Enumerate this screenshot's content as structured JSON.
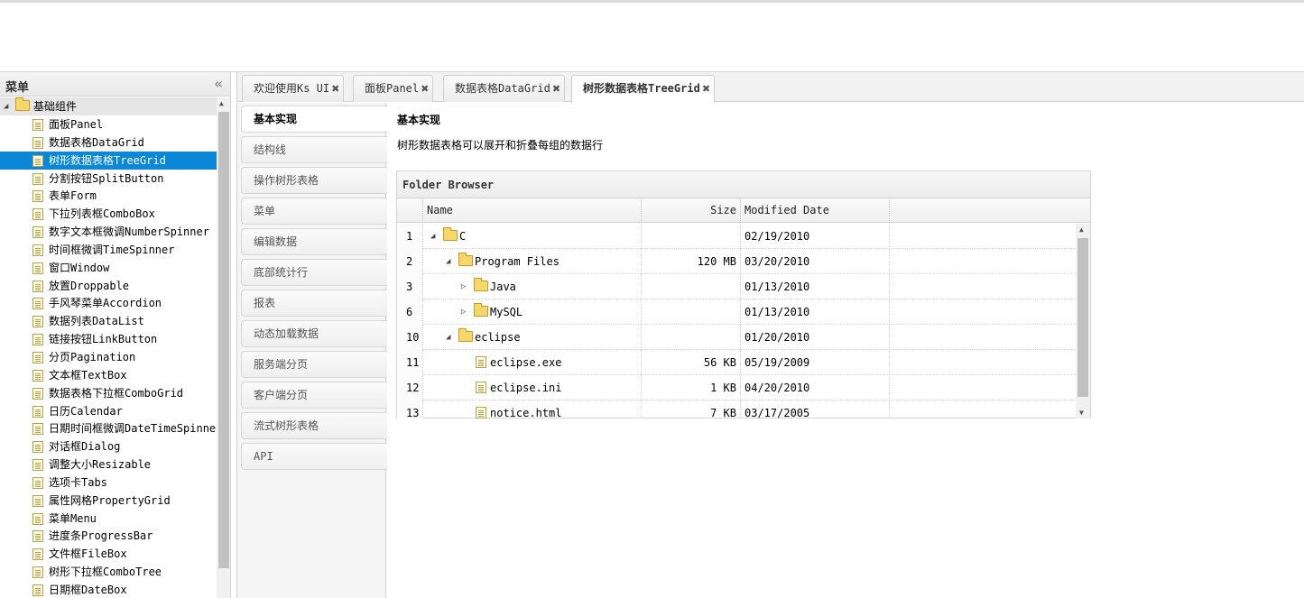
{
  "menu": {
    "title": "菜单",
    "root_label": "基础组件",
    "items": [
      "面板Panel",
      "数据表格DataGrid",
      "树形数据表格TreeGrid",
      "分割按钮SplitButton",
      "表单Form",
      "下拉列表框ComboBox",
      "数字文本框微调NumberSpinner",
      "时间框微调TimeSpinner",
      "窗口Window",
      "放置Droppable",
      "手风琴菜单Accordion",
      "数据列表DataList",
      "链接按钮LinkButton",
      "分页Pagination",
      "文本框TextBox",
      "数据表格下拉框ComboGrid",
      "日历Calendar",
      "日期时间框微调DateTimeSpinner",
      "对话框Dialog",
      "调整大小Resizable",
      "选项卡Tabs",
      "属性网格PropertyGrid",
      "菜单Menu",
      "进度条ProgressBar",
      "文件框FileBox",
      "树形下拉框ComboTree",
      "日期框DateBox"
    ],
    "selected_index": 2
  },
  "tabs": [
    "欢迎使用Ks UI",
    "面板Panel",
    "数据表格DataGrid",
    "树形数据表格TreeGrid"
  ],
  "active_tab": 3,
  "subtabs": [
    "基本实现",
    "结构线",
    "操作树形表格",
    "菜单",
    "编辑数据",
    "底部统计行",
    "报表",
    "动态加载数据",
    "服务端分页",
    "客户端分页",
    "流式树形表格",
    "API"
  ],
  "content": {
    "title": "基本实现",
    "description": "树形数据表格可以展开和折叠每组的数据行"
  },
  "grid": {
    "title": "Folder Browser",
    "columns": [
      "Name",
      "Size",
      "Modified Date"
    ],
    "rows": [
      {
        "num": "1",
        "name": "C",
        "size": "",
        "date": "02/19/2010",
        "type": "folder",
        "level": 0,
        "state": "open"
      },
      {
        "num": "2",
        "name": "Program Files",
        "size": "120 MB",
        "date": "03/20/2010",
        "type": "folder",
        "level": 1,
        "state": "open"
      },
      {
        "num": "3",
        "name": "Java",
        "size": "",
        "date": "01/13/2010",
        "type": "folder",
        "level": 2,
        "state": "closed"
      },
      {
        "num": "6",
        "name": "MySQL",
        "size": "",
        "date": "01/13/2010",
        "type": "folder",
        "level": 2,
        "state": "closed"
      },
      {
        "num": "10",
        "name": "eclipse",
        "size": "",
        "date": "01/20/2010",
        "type": "folder",
        "level": 1,
        "state": "open"
      },
      {
        "num": "11",
        "name": "eclipse.exe",
        "size": "56 KB",
        "date": "05/19/2009",
        "type": "file",
        "level": 2,
        "state": ""
      },
      {
        "num": "12",
        "name": "eclipse.ini",
        "size": "1 KB",
        "date": "04/20/2010",
        "type": "file",
        "level": 2,
        "state": ""
      },
      {
        "num": "13",
        "name": "notice.html",
        "size": "7 KB",
        "date": "03/17/2005",
        "type": "file",
        "level": 2,
        "state": ""
      }
    ]
  },
  "colors": {
    "selected_bg": "#0a87d6",
    "folder": "#f7d66a"
  },
  "icons": {
    "collapse": "double-chevron-left-icon",
    "tab_close": "close-icon"
  }
}
